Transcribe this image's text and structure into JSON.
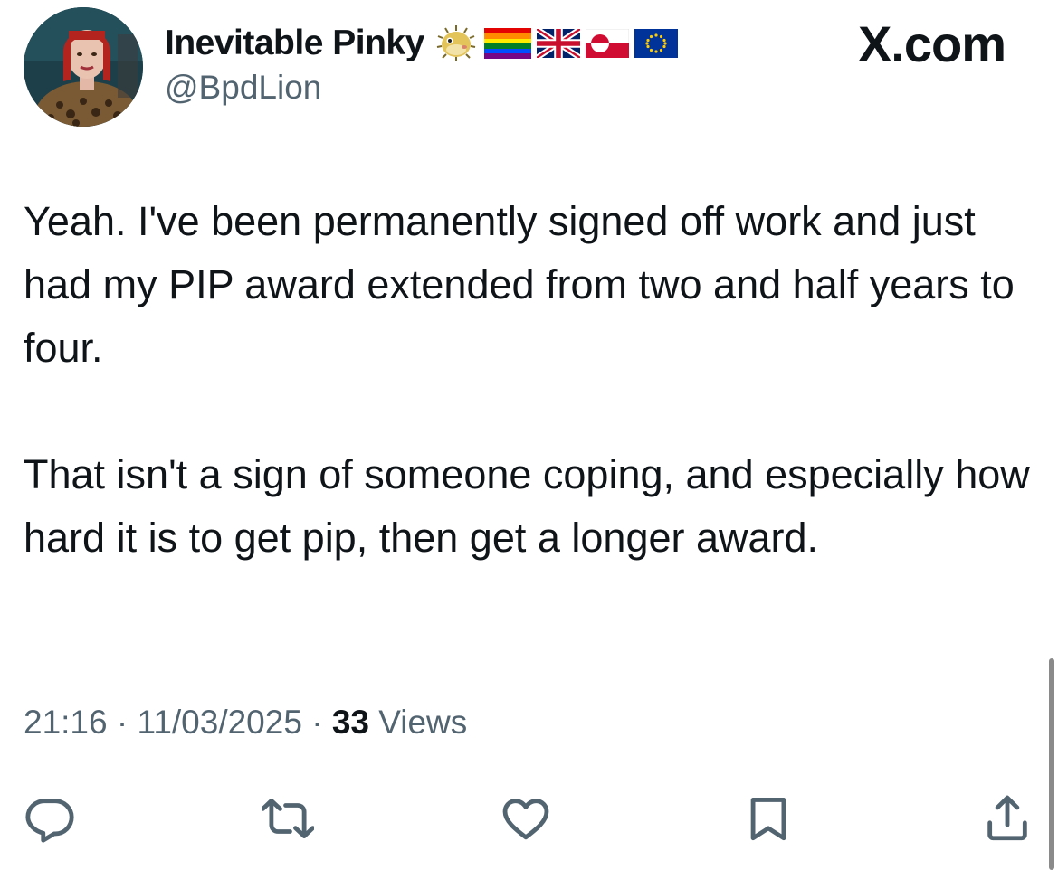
{
  "user": {
    "display_name": "Inevitable Pinky",
    "handle": "@BpdLion",
    "name_emojis": [
      "blowfish",
      "rainbow-flag",
      "united-kingdom-flag",
      "greenland-flag",
      "european-union-flag"
    ]
  },
  "brand": "X.com",
  "tweet": {
    "paragraphs": [
      "Yeah. I've been permanently signed off work and just had my PIP award extended from two and half years to four.",
      "That isn't a sign of someone coping, and especially how hard it is to get pip, then get a longer award."
    ],
    "time": "21:16",
    "date": "11/03/2025",
    "separator": "·",
    "views_count": "33",
    "views_label": "Views"
  },
  "actions": [
    "reply-icon",
    "repost-icon",
    "like-icon",
    "bookmark-icon",
    "share-icon"
  ],
  "colors": {
    "text_primary": "#0f1419",
    "text_secondary": "#536471",
    "icon": "#536471"
  }
}
